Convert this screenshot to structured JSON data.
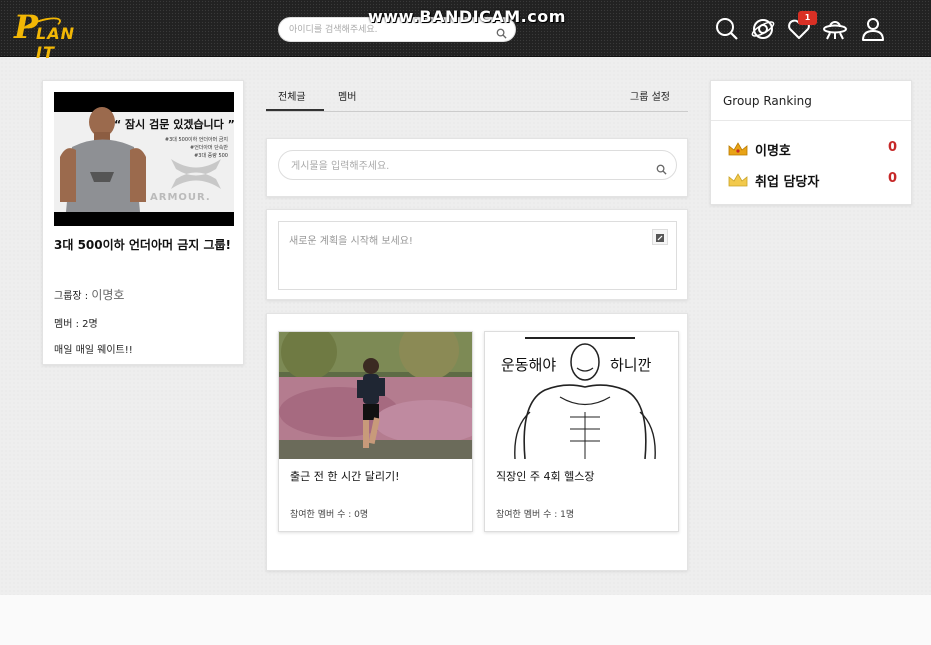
{
  "header": {
    "logo_p": "P",
    "logo_rest": "LAN IT",
    "search_placeholder": "아이디를 검색해주세요.",
    "watermark": "www.BANDICAM.com",
    "notification_count": "1",
    "icons": [
      "search-icon",
      "planet-icon",
      "heart-icon",
      "ufo-icon",
      "user-icon"
    ]
  },
  "group": {
    "image_quote": "“ 잠시 검문 있겠습니다 ”",
    "image_lines": [
      "#3대 500이하 언더아머 금지",
      "#언더아머 단속반",
      "#3대 증량 500"
    ],
    "image_brand": "ARMOUR.",
    "title": "3대 500이하 언더아머 금지 그룹!",
    "leader_label": "그룹장 : ",
    "leader_value": "이명호",
    "members_label": "멤버 : ",
    "members_value": "2명",
    "description": "매일 매일 웨이트!!"
  },
  "tabs": {
    "all": "전체글",
    "members": "멤버",
    "settings": "그룹 설정"
  },
  "post_search": {
    "placeholder": "게시물을 입력해주세요."
  },
  "new_plan": {
    "placeholder": "새로운 계획을 시작해 보세요!"
  },
  "plans": [
    {
      "title": "출근 전 한 시간 달리기!",
      "member_label": "참여한 멤버 수 : ",
      "member_count": "0명"
    },
    {
      "title": "직장인 주 4회 헬스장",
      "member_label": "참여한 멤버 수 : ",
      "member_count": "1명",
      "image_text_top": "운동해야",
      "image_text_right": "하니깐"
    }
  ],
  "ranking": {
    "title": "Group Ranking",
    "entries": [
      {
        "name": "이명호",
        "score": "0",
        "crown_color": "#e8a317"
      },
      {
        "name": "취업 담당자",
        "score": "0",
        "crown_color": "#f2c94c"
      }
    ]
  },
  "colors": {
    "accent": "#f2b705",
    "score": "#c62828",
    "badge": "#d93025"
  }
}
